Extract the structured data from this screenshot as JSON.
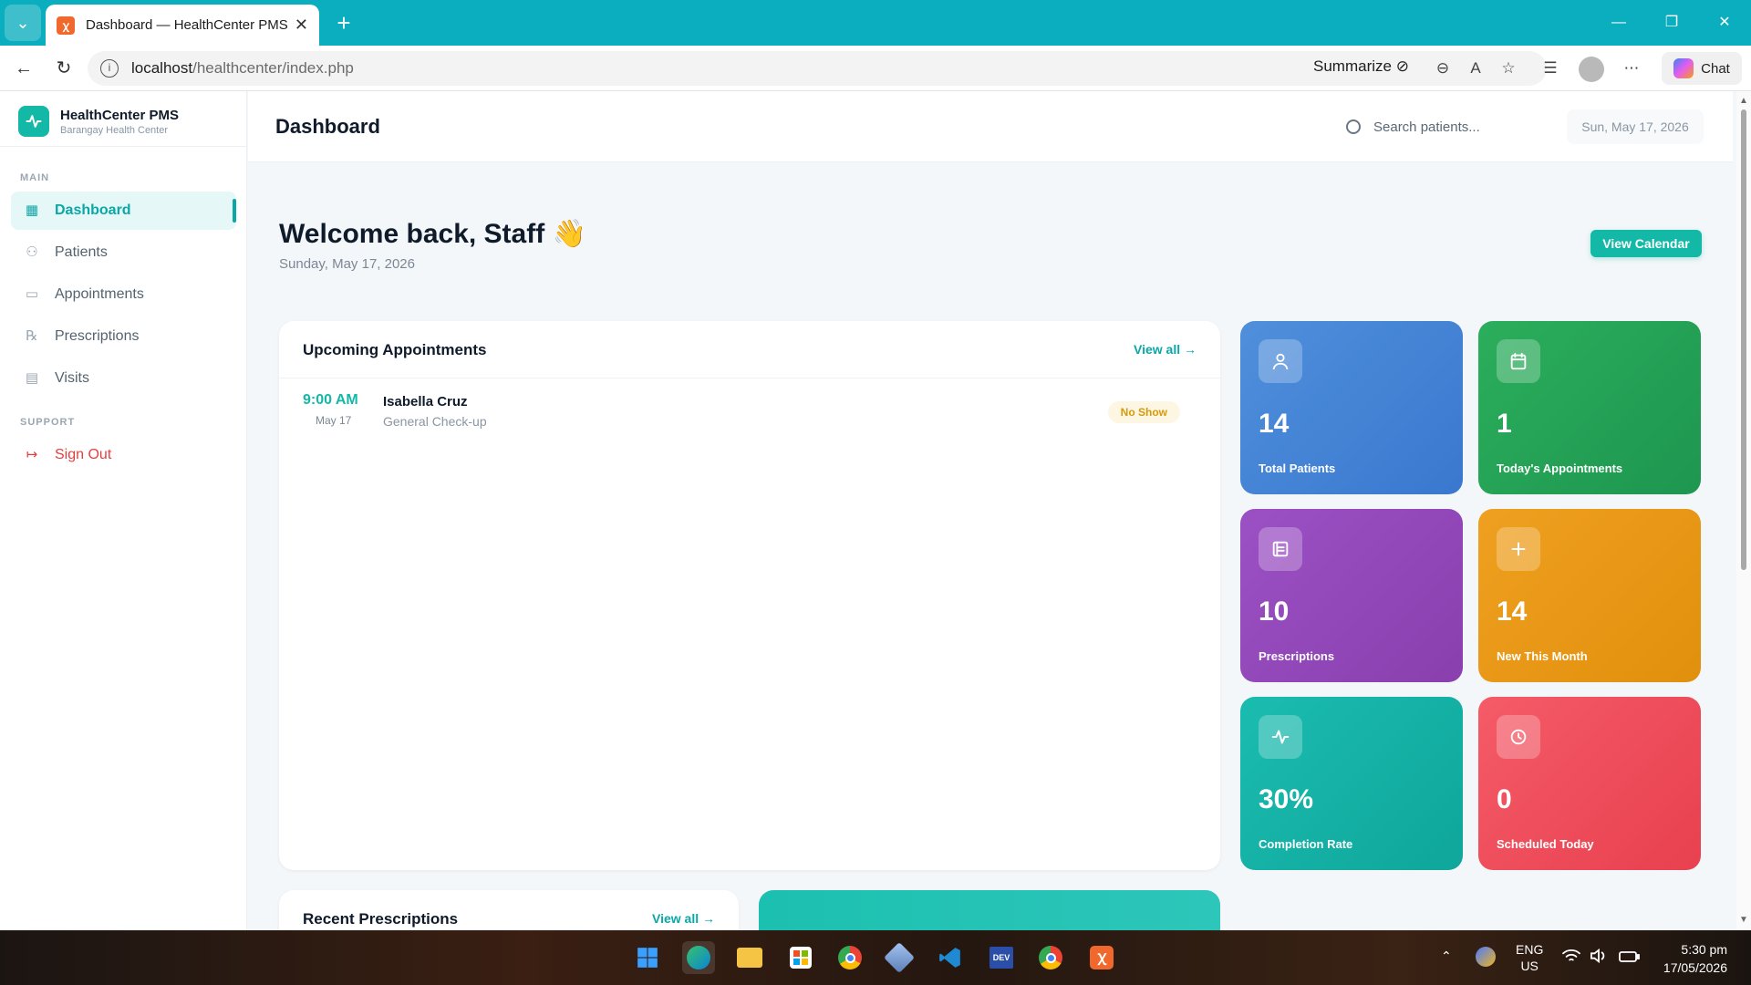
{
  "browser": {
    "tab_title": "Dashboard — HealthCenter PMS",
    "url_host": "localhost",
    "url_path": "/healthcenter/index.php",
    "summarize_label": "Summarize",
    "chat_label": "Chat"
  },
  "sidebar": {
    "brand_name": "HealthCenter PMS",
    "brand_sub": "Barangay Health Center",
    "section_main": "MAIN",
    "section_support": "SUPPORT",
    "items": [
      {
        "label": "Dashboard",
        "icon": "grid-icon",
        "active": true
      },
      {
        "label": "Patients",
        "icon": "users-icon"
      },
      {
        "label": "Appointments",
        "icon": "calendar-icon"
      },
      {
        "label": "Prescriptions",
        "icon": "prescription-icon"
      },
      {
        "label": "Visits",
        "icon": "document-icon"
      }
    ],
    "signout": "Sign Out"
  },
  "topbar": {
    "title": "Dashboard",
    "search_placeholder": "Search patients...",
    "date": "Sun, May 17, 2026"
  },
  "welcome": {
    "heading": "Welcome back, Staff 👋",
    "date": "Sunday, May 17, 2026",
    "view_calendar": "View Calendar"
  },
  "upcoming": {
    "title": "Upcoming Appointments",
    "view_all": "View all →",
    "rows": [
      {
        "time": "9:00 AM",
        "day": "May 17",
        "name": "Isabella Cruz",
        "type": "General Check-up",
        "status": "No Show"
      }
    ]
  },
  "recent": {
    "title": "Recent Prescriptions",
    "view_all": "View all →"
  },
  "stats": [
    {
      "value": "14",
      "label": "Total Patients",
      "icon": "user-icon",
      "color": "#3b82d6"
    },
    {
      "value": "1",
      "label": "Today's Appointments",
      "icon": "calendar-icon",
      "color": "#20a055"
    },
    {
      "value": "10",
      "label": "Prescriptions",
      "icon": "prescription-icon",
      "color": "#8e44ad"
    },
    {
      "value": "14",
      "label": "New This Month",
      "icon": "plus-icon",
      "color": "#e8960d"
    },
    {
      "value": "30%",
      "label": "Completion Rate",
      "icon": "activity-icon",
      "color": "#16b3a6"
    },
    {
      "value": "0",
      "label": "Scheduled Today",
      "icon": "clock-icon",
      "color": "#ee4a5a"
    }
  ],
  "taskbar": {
    "lang": "ENG",
    "region": "US",
    "time": "5:30 pm",
    "date": "17/05/2026"
  }
}
